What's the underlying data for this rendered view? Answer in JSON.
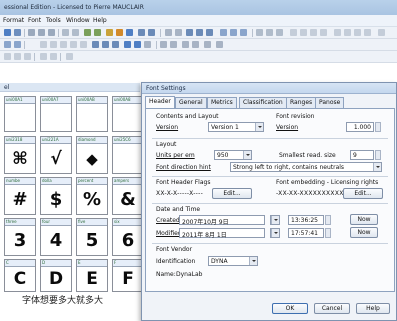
{
  "app": {
    "title": "essional Edition - Licensed to Pierre MAUCLAIR",
    "menu": [
      "Format",
      "Font",
      "Tools",
      "Window",
      "Help"
    ]
  },
  "subwindow": {
    "title": "el"
  },
  "glyph_grid": {
    "rows": [
      [
        {
          "label": "uni00A1",
          "glyph": ""
        },
        {
          "label": "uni00A7",
          "glyph": ""
        },
        {
          "label": "uni00AB",
          "glyph": ""
        },
        {
          "label": "uni00A8",
          "glyph": ""
        }
      ],
      [
        {
          "label": "uni2318",
          "glyph": "⌘"
        },
        {
          "label": "uni221A",
          "glyph": "√"
        },
        {
          "label": "diamond",
          "glyph": "◆"
        },
        {
          "label": "uni25C6",
          "glyph": ""
        }
      ],
      [
        {
          "label": "numbe",
          "glyph": "#"
        },
        {
          "label": "dolla",
          "glyph": "$"
        },
        {
          "label": "percent",
          "glyph": "%"
        },
        {
          "label": "ampers",
          "glyph": "&"
        }
      ],
      [
        {
          "label": "three",
          "glyph": "3"
        },
        {
          "label": "four",
          "glyph": "4"
        },
        {
          "label": "five",
          "glyph": "5"
        },
        {
          "label": "six",
          "glyph": "6"
        }
      ],
      [
        {
          "label": "C",
          "glyph": "C"
        },
        {
          "label": "D",
          "glyph": "D"
        },
        {
          "label": "E",
          "glyph": "E"
        },
        {
          "label": "F",
          "glyph": "F"
        }
      ]
    ],
    "caption": "字体想要多大就多大"
  },
  "dialog": {
    "title": "Font Settings",
    "tabs": [
      "Header",
      "General",
      "Metrics",
      "Classification",
      "Ranges",
      "Panose"
    ],
    "active_tab": "Header",
    "contents_layout": {
      "heading": "Contents and Layout",
      "version_label": "Version",
      "version_value": "Version 1"
    },
    "font_revision": {
      "heading": "Font revision",
      "version_label": "Version",
      "version_value": "1.000"
    },
    "layout": {
      "heading": "Layout",
      "units_label": "Units per em",
      "units_value": "950",
      "smallest_label": "Smallest read. size",
      "smallest_value": "9",
      "direction_label": "Font direction hint",
      "direction_value": "Strong left to right, contains neutrals"
    },
    "header_flags": {
      "heading": "Font Header Flags",
      "value": "XX-X-X-----X----",
      "edit": "Edit..."
    },
    "embedding": {
      "heading": "Font embedding - Licensing rights",
      "value": "-XX-XX-XXXXXXXXXX",
      "edit": "Edit..."
    },
    "date_time": {
      "heading": "Date and Time",
      "created_label": "Created",
      "created_date": "2007年10月 9日",
      "created_time": "13:36:25",
      "modified_label": "Modified",
      "modified_date": "2011年 8月 1日",
      "modified_time": "17:57:41",
      "now": "Now"
    },
    "vendor": {
      "heading": "Font Vendor",
      "id_label": "Identification",
      "id_value": "DYNA",
      "name_label": "Name:",
      "name_value": "DynaLab"
    },
    "buttons": {
      "ok": "OK",
      "cancel": "Cancel",
      "help": "Help"
    }
  }
}
